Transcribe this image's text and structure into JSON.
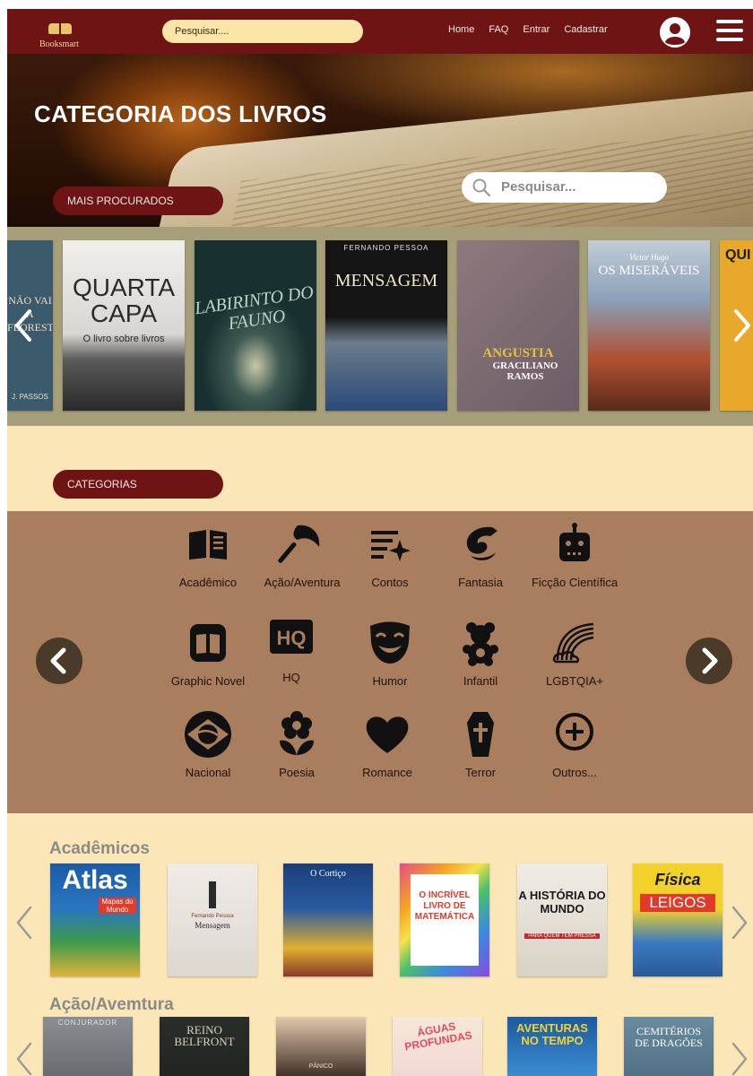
{
  "header": {
    "logo_text": "Booksmart",
    "search_placeholder": "Pesquisar....",
    "nav_links": [
      "Home",
      "FAQ",
      "Entrar",
      "Cadastrar"
    ]
  },
  "hero": {
    "title": "CATEGORIA DOS LIVROS",
    "search_placeholder": "Pesquisar...",
    "featured_label": "MAIS PROCURADOS"
  },
  "featured_books": [
    {
      "title": "NÃO VAI A FLORESTA",
      "author": "J. PASSOS",
      "bg": "#3b5a6b"
    },
    {
      "title": "QUARTA CAPA",
      "subtitle": "O livro sobre livros",
      "bg": "#e8e6e2"
    },
    {
      "title": "LABIRINTO DO FAUNO",
      "bg": "#21393a"
    },
    {
      "title": "MENSAGEM",
      "author": "FERNANDO PESSOA",
      "bg": "#141414"
    },
    {
      "title": "ANGUSTIA",
      "author": "GRACILIANO RAMOS",
      "bg": "#7d6a72"
    },
    {
      "title": "OS MISERÁVEIS",
      "author": "Victor Hugo",
      "bg": "#a9b7c4"
    },
    {
      "title": "QUI",
      "bg": "#e8a92a"
    }
  ],
  "categories_label": "CATEGORIAS",
  "categories": [
    {
      "label": "Acadêmico",
      "icon": "open-book-icon"
    },
    {
      "label": "Ação/Aventura",
      "icon": "axe-icon"
    },
    {
      "label": "Contos",
      "icon": "sparkle-list-icon"
    },
    {
      "label": "Fantasia",
      "icon": "dragon-icon"
    },
    {
      "label": "Ficção Científica",
      "icon": "robot-icon"
    },
    {
      "label": "Graphic Novel",
      "icon": "graphic-novel-icon"
    },
    {
      "label": "HQ",
      "icon": "hq-icon"
    },
    {
      "label": "Humor",
      "icon": "smile-mask-icon"
    },
    {
      "label": "Infantil",
      "icon": "teddy-bear-icon"
    },
    {
      "label": "LGBTQIA+",
      "icon": "rainbow-icon"
    },
    {
      "label": "Nacional",
      "icon": "brazil-flag-icon"
    },
    {
      "label": "Poesia",
      "icon": "flower-icon"
    },
    {
      "label": "Romance",
      "icon": "heart-icon"
    },
    {
      "label": "Terror",
      "icon": "coffin-icon"
    },
    {
      "label": "Outros...",
      "icon": "plus-circle-icon"
    }
  ],
  "shelves": [
    {
      "title": "Acadêmicos",
      "books": [
        {
          "title": "Atlas",
          "subtitle": "Mapas do Mundo"
        },
        {
          "title": "Mensagem",
          "subtitle": "Fernando Pessoa"
        },
        {
          "title": "O Cortiço"
        },
        {
          "title": "O INCRÍVEL LIVRO DE MATEMÁTICA"
        },
        {
          "title": "A HISTÓRIA DO MUNDO",
          "subtitle": "PARA QUEM TEM PRESSA"
        },
        {
          "title": "Física",
          "subtitle": "LEIGOS"
        }
      ]
    },
    {
      "title": "Ação/Avemtura",
      "books": [
        {
          "title": "CONJURADOR"
        },
        {
          "title": "REINO BELFRONT"
        },
        {
          "title": "PÂNICO"
        },
        {
          "title": "ÁGUAS PROFUNDAS"
        },
        {
          "title": "AVENTURAS NO TEMPO"
        },
        {
          "title": "CEMITÉRIOS DE DRAGÕES"
        }
      ]
    }
  ],
  "colors": {
    "nav_bg": "#6e1414",
    "page_bg": "#fbe6b7",
    "categories_bg": "#a97e5f",
    "carousel_bg": "#a69f7a"
  }
}
